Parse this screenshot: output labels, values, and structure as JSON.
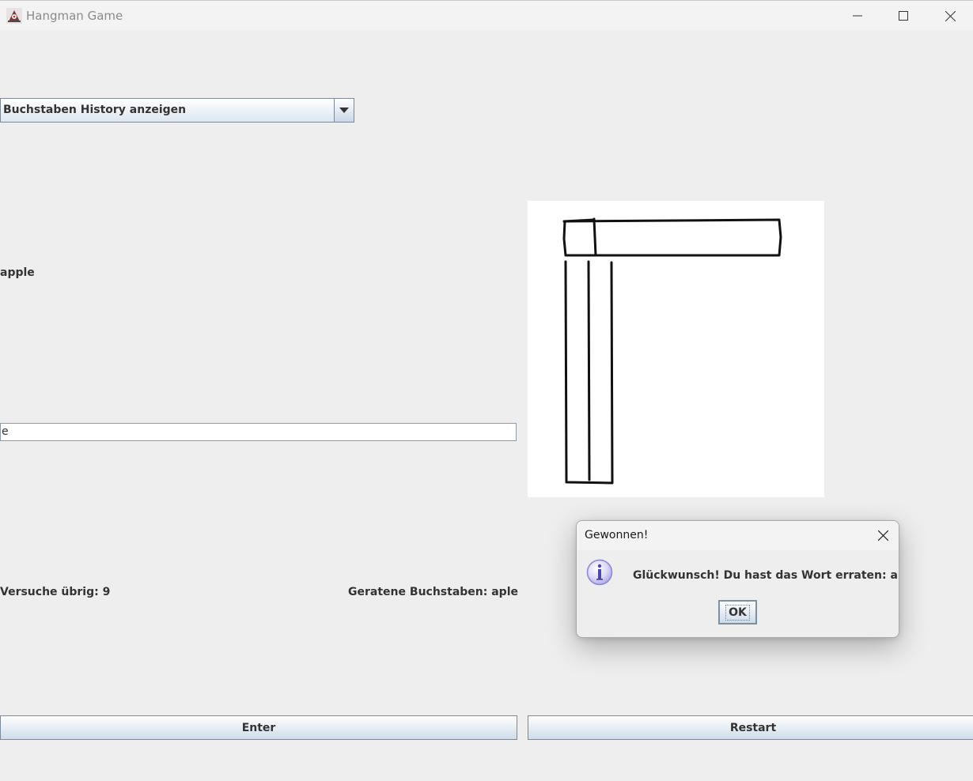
{
  "window": {
    "title": "Hangman Game",
    "app_icon": "java-duke-icon",
    "controls": [
      "minimize-icon",
      "maximize-icon",
      "close-icon"
    ]
  },
  "combo": {
    "selected": "Buchstaben History anzeigen"
  },
  "word_display": "apple",
  "input": {
    "value": "e"
  },
  "status": {
    "attempts": "Versuche übrig: 9",
    "guessed": "Geratene Buchstaben: aple"
  },
  "buttons": {
    "enter": "Enter",
    "restart": "Restart"
  },
  "dialog": {
    "title": "Gewonnen!",
    "icon": "info-icon",
    "message": "Glückwunsch! Du hast das Wort erraten: apple",
    "ok": "OK"
  },
  "colors": {
    "background": "#eeeeee",
    "button_gradient_top": "#ffffff",
    "button_gradient_bottom": "#cfdcea",
    "info_icon": "#8a86d8"
  }
}
